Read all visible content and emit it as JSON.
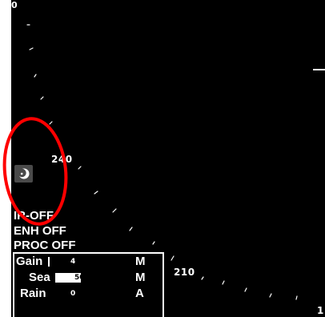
{
  "radar": {
    "bearing_top": "0",
    "bearing_240": "240",
    "bearing_210": "210",
    "bearing_edge": "1"
  },
  "status": {
    "ir": "IR-OFF",
    "enh": "ENH OFF",
    "proc": "PROC OFF"
  },
  "adjust": {
    "rows": [
      {
        "label": "Gain",
        "value": "4",
        "mode": "M",
        "level": 0.04
      },
      {
        "label": "Sea",
        "value": "50",
        "mode": "M",
        "level": 0.5
      },
      {
        "label": "Rain",
        "value": "0",
        "mode": "A",
        "level": 0
      }
    ]
  },
  "icons": {
    "day_night": "moon-icon",
    "annotation": "red-ellipse-highlight"
  },
  "colors": {
    "screen": "#000000",
    "text": "#ffffff",
    "highlight": "#ff0000",
    "button": "#4a4a4a"
  }
}
